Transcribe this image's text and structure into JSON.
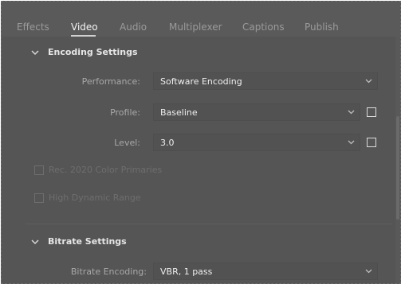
{
  "tabs": [
    {
      "label": "Effects",
      "active": false
    },
    {
      "label": "Video",
      "active": true
    },
    {
      "label": "Audio",
      "active": false
    },
    {
      "label": "Multiplexer",
      "active": false
    },
    {
      "label": "Captions",
      "active": false
    },
    {
      "label": "Publish",
      "active": false
    }
  ],
  "encoding": {
    "title": "Encoding Settings",
    "performance": {
      "label": "Performance:",
      "value": "Software Encoding"
    },
    "profile": {
      "label": "Profile:",
      "value": "Baseline",
      "checked": false
    },
    "level": {
      "label": "Level:",
      "value": "3.0",
      "checked": false
    },
    "rec2020": {
      "label": "Rec. 2020 Color Primaries",
      "checked": false,
      "enabled": false
    },
    "hdr": {
      "label": "High Dynamic Range",
      "checked": false,
      "enabled": false
    }
  },
  "bitrate": {
    "title": "Bitrate Settings",
    "encoding": {
      "label": "Bitrate Encoding:",
      "value": "VBR, 1 pass"
    }
  },
  "colors": {
    "panel_bg": "#555555",
    "active_tab": "#f4f4f4",
    "inactive_tab": "#9a9a9a"
  }
}
